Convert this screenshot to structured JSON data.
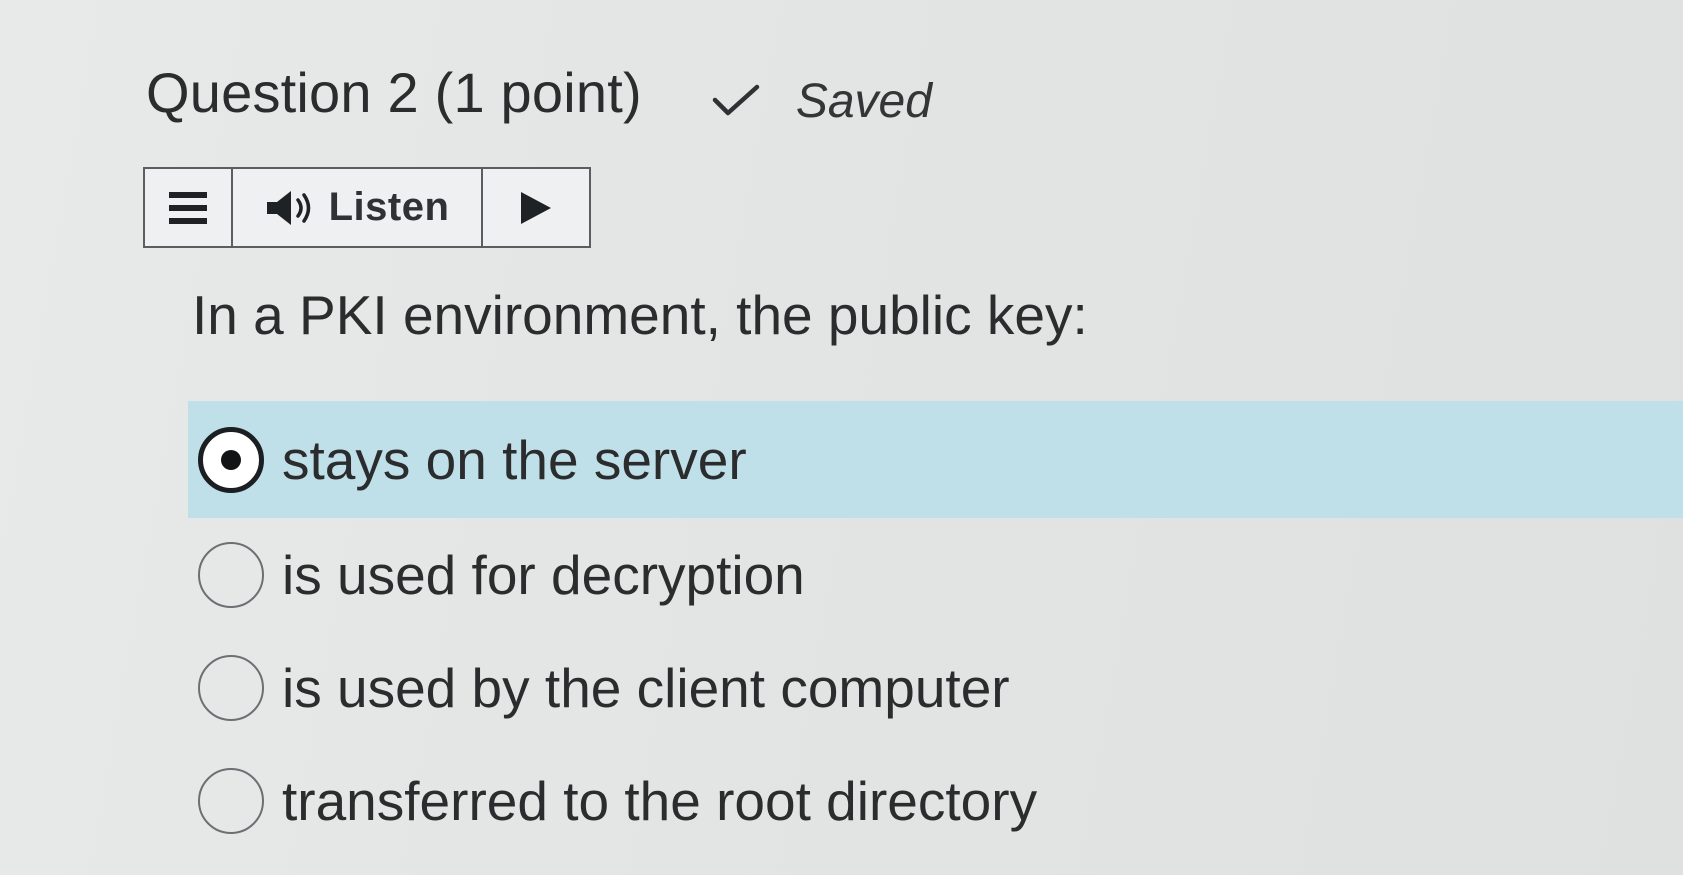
{
  "question": {
    "title": "Question 2 (1 point)",
    "status": "Saved",
    "status_icon": "checkmark-icon"
  },
  "toolbar": {
    "menu_icon": "hamburger-menu-icon",
    "listen_icon": "speaker-icon",
    "listen_label": "Listen",
    "play_icon": "play-icon"
  },
  "prompt": "In a PKI environment, the public key:",
  "options": [
    {
      "label": "stays on the server",
      "selected": true
    },
    {
      "label": "is used for decryption",
      "selected": false
    },
    {
      "label": "is used by the client computer",
      "selected": false
    },
    {
      "label": "transferred to the root directory",
      "selected": false
    }
  ],
  "colors": {
    "selected_row": "#bfdfe9",
    "text": "#2a2c2d",
    "toolbar_border": "#5a5e61"
  }
}
